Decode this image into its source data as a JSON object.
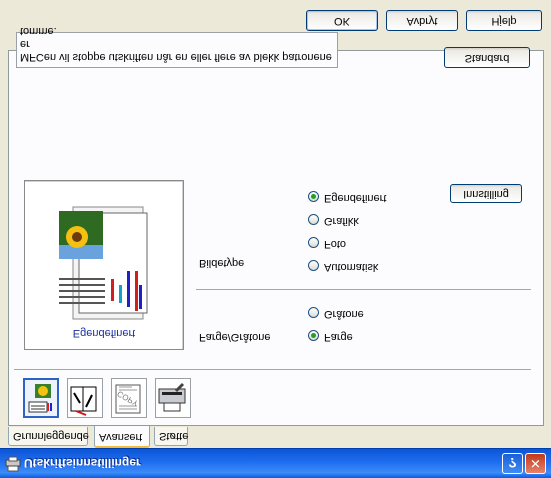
{
  "window": {
    "title": "Utskriftsinnstillinger",
    "help_glyph": "?",
    "close_glyph": "✕"
  },
  "tabs": [
    {
      "label": "Grunnleggende"
    },
    {
      "label": "Avansert",
      "active": true
    },
    {
      "label": "Støtte"
    }
  ],
  "icon_bar": [
    {
      "icon": "print-quality-icon",
      "active": true
    },
    {
      "icon": "duplex-booklet-icon"
    },
    {
      "icon": "watermark-icon",
      "text": "COPY"
    },
    {
      "icon": "device-options-icon"
    }
  ],
  "preview": {
    "caption": "Egendefinert"
  },
  "farge_group": {
    "label": "Farge/Gråtone",
    "options": [
      {
        "label": "Farge",
        "checked": true
      },
      {
        "label": "Gråtone",
        "checked": false
      }
    ]
  },
  "bildetype_group": {
    "label": "Bildetype",
    "options": [
      {
        "label": "Automatisk",
        "checked": false
      },
      {
        "label": "Foto",
        "checked": false
      },
      {
        "label": "Grafikk",
        "checked": false
      },
      {
        "label": "Egendefinert",
        "checked": true
      }
    ],
    "settings_button": "Innstilling"
  },
  "default_button": "Standard",
  "info_text": {
    "line1": "MFCen vil stoppe utskriften når en eller flere av blekk patronene er",
    "line2": "tomme."
  },
  "footer": {
    "ok": "OK",
    "cancel": "Avbryt",
    "help": "Hjelp"
  },
  "colors": {
    "titlebar": "#1f6ef0",
    "tab_highlight": "#f5b93b",
    "radio_dot": "#21a121",
    "panel": "#fcfcfe",
    "dialog_bg": "#ece9d8"
  }
}
